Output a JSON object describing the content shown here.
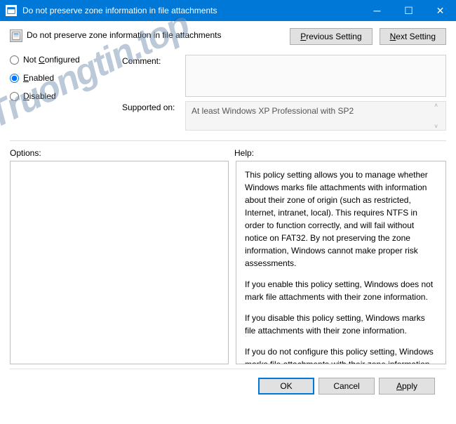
{
  "titlebar": {
    "title": "Do not preserve zone information in file attachments"
  },
  "header": {
    "policy_title": "Do not preserve zone information in file attachments",
    "previous_btn": "Previous Setting",
    "next_btn": "Next Setting"
  },
  "radio": {
    "not_configured": "Not Configured",
    "enabled": "Enabled",
    "disabled": "Disabled",
    "selected": "enabled"
  },
  "mid": {
    "comment_label": "Comment:",
    "comment_value": "",
    "supported_label": "Supported on:",
    "supported_value": "At least Windows XP Professional with SP2"
  },
  "labels": {
    "options": "Options:",
    "help": "Help:"
  },
  "help": {
    "p1": "This policy setting allows you to manage whether Windows marks file attachments with information about their zone of origin (such as restricted, Internet, intranet, local). This requires NTFS in order to function correctly, and will fail without notice on FAT32. By not preserving the zone information, Windows cannot make proper risk assessments.",
    "p2": "If you enable this policy setting, Windows does not mark file attachments with their zone information.",
    "p3": "If you disable this policy setting, Windows marks file attachments with their zone information.",
    "p4": "If you do not configure this policy setting, Windows marks file attachments with their zone information."
  },
  "footer": {
    "ok": "OK",
    "cancel": "Cancel",
    "apply": "Apply"
  },
  "watermark": "Truongtin.top"
}
